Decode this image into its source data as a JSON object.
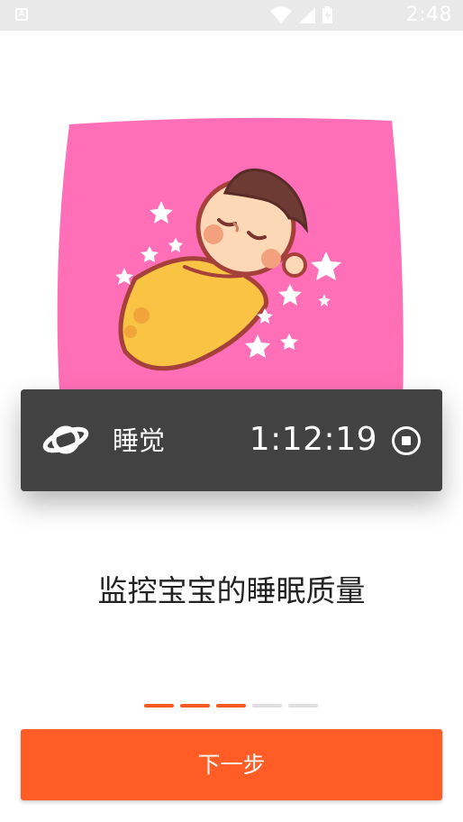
{
  "status_bar": {
    "notification_icon": "a-icon",
    "icons": [
      "wifi-icon",
      "signal-icon",
      "battery-icon"
    ],
    "time": "2:48"
  },
  "onboarding": {
    "illustration": "sleeping-baby-swaddle",
    "timer_card": {
      "icon": "planet-icon",
      "label": "睡觉",
      "time": "1:12:19",
      "action_icon": "stop-icon"
    },
    "headline": "监控宝宝的睡眠质量",
    "pager": {
      "total": 5,
      "active_count": 3,
      "active_color": "#f45a26",
      "inactive_color": "#e0e0e0"
    },
    "next_button": {
      "label": "下一步",
      "color": "#ff5c26"
    }
  },
  "colors": {
    "illustration_bg": "#ff6fb7",
    "card_bg": "#424242",
    "swaddle": "#f9c343"
  }
}
